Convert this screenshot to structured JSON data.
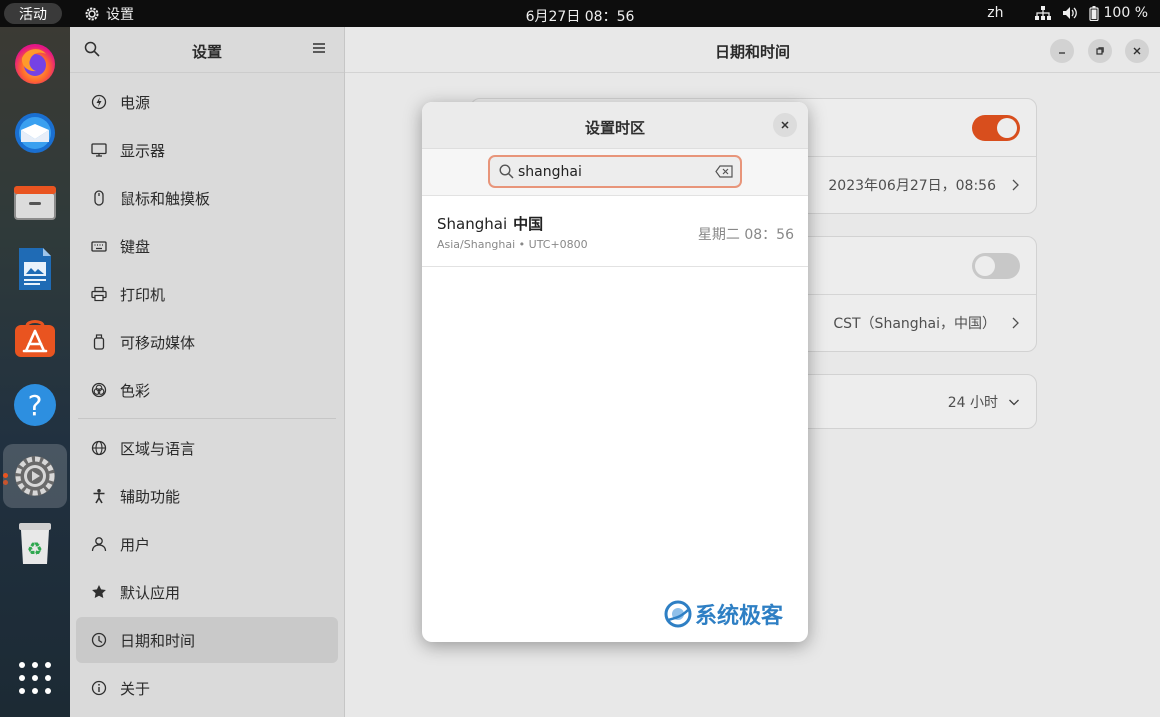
{
  "topbar": {
    "activities": "活动",
    "app_name": "设置",
    "clock": "6月27日  08：56",
    "lang": "zh",
    "battery": "100 %"
  },
  "dock": {
    "items": [
      "firefox-icon",
      "thunderbird-icon",
      "files-icon",
      "libreoffice-writer-icon",
      "app-center-icon",
      "help-icon",
      "settings-icon",
      "trash-icon",
      "show-apps-icon"
    ]
  },
  "sidebar": {
    "title": "设置",
    "items": [
      {
        "label": "电源",
        "icon": "power-icon"
      },
      {
        "label": "显示器",
        "icon": "display-icon"
      },
      {
        "label": "鼠标和触摸板",
        "icon": "mouse-icon"
      },
      {
        "label": "键盘",
        "icon": "keyboard-icon"
      },
      {
        "label": "打印机",
        "icon": "printer-icon"
      },
      {
        "label": "可移动媒体",
        "icon": "removable-media-icon"
      },
      {
        "label": "色彩",
        "icon": "color-icon"
      },
      {
        "label": "区域与语言",
        "icon": "globe-icon"
      },
      {
        "label": "辅助功能",
        "icon": "accessibility-icon"
      },
      {
        "label": "用户",
        "icon": "user-icon"
      },
      {
        "label": "默认应用",
        "icon": "star-icon"
      },
      {
        "label": "日期和时间",
        "icon": "clock-icon"
      },
      {
        "label": "关于",
        "icon": "info-icon"
      }
    ],
    "selected": "日期和时间"
  },
  "content": {
    "title": "日期和时间",
    "date_time_value": "2023年06月27日，08:56",
    "timezone_value": "CST（Shanghai，中国）",
    "time_format_value": "24 小时",
    "auto_datetime_on": true,
    "auto_timezone_on": false
  },
  "dialog": {
    "title": "设置时区",
    "search_value": "shanghai",
    "results": [
      {
        "city": "Shanghai",
        "country": "中国",
        "sub": "Asia/Shanghai  •  UTC+0800",
        "time": "星期二 08：56"
      }
    ]
  },
  "watermark": "系统极客"
}
